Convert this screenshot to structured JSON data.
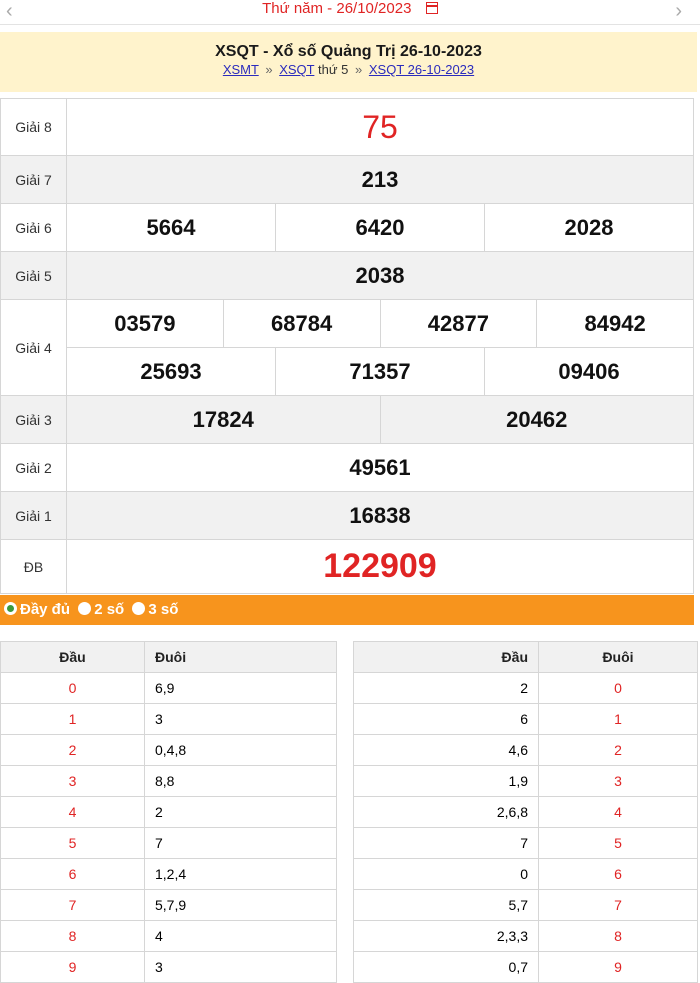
{
  "header": {
    "date_text": "Thứ năm -  26/10/2023",
    "prev_icon": "chevron-left-icon",
    "next_icon": "chevron-right-icon",
    "calendar_icon": "calendar-icon"
  },
  "title": {
    "text": "XSQT - Xổ số Quảng Trị 26-10-2023",
    "crumb1": "XSMT",
    "sep": "»",
    "crumb2": "XSQT",
    "crumb2_suffix": "thứ 5",
    "crumb3": "XSQT 26-10-2023"
  },
  "prizes": {
    "g8": {
      "label": "Giải 8",
      "values": [
        "75"
      ]
    },
    "g7": {
      "label": "Giải 7",
      "values": [
        "213"
      ]
    },
    "g6": {
      "label": "Giải 6",
      "values": [
        "5664",
        "6420",
        "2028"
      ]
    },
    "g5": {
      "label": "Giải 5",
      "values": [
        "2038"
      ]
    },
    "g4": {
      "label": "Giải 4",
      "values": [
        "03579",
        "68784",
        "42877",
        "84942",
        "25693",
        "71357",
        "09406"
      ]
    },
    "g3": {
      "label": "Giải 3",
      "values": [
        "17824",
        "20462"
      ]
    },
    "g2": {
      "label": "Giải 2",
      "values": [
        "49561"
      ]
    },
    "g1": {
      "label": "Giải 1",
      "values": [
        "16838"
      ]
    },
    "db": {
      "label": "ĐB",
      "values": [
        "122909"
      ]
    }
  },
  "filter": {
    "options": [
      "Đầy đủ",
      "2 số",
      "3 số"
    ],
    "selected": "Đầy đủ"
  },
  "loto_left": {
    "headers": [
      "Đầu",
      "Đuôi"
    ],
    "rows": [
      [
        "0",
        "6,9"
      ],
      [
        "1",
        "3"
      ],
      [
        "2",
        "0,4,8"
      ],
      [
        "3",
        "8,8"
      ],
      [
        "4",
        "2"
      ],
      [
        "5",
        "7"
      ],
      [
        "6",
        "1,2,4"
      ],
      [
        "7",
        "5,7,9"
      ],
      [
        "8",
        "4"
      ],
      [
        "9",
        "3"
      ]
    ]
  },
  "loto_right": {
    "headers": [
      "Đầu",
      "Đuôi"
    ],
    "rows": [
      [
        "2",
        "0"
      ],
      [
        "6",
        "1"
      ],
      [
        "4,6",
        "2"
      ],
      [
        "1,9",
        "3"
      ],
      [
        "2,6,8",
        "4"
      ],
      [
        "7",
        "5"
      ],
      [
        "0",
        "6"
      ],
      [
        "5,7",
        "7"
      ],
      [
        "2,3,3",
        "8"
      ],
      [
        "0,7",
        "9"
      ]
    ]
  },
  "colors": {
    "accent_red": "#e02424",
    "filter_orange": "#f7941d",
    "title_bg": "#fff3cc"
  }
}
